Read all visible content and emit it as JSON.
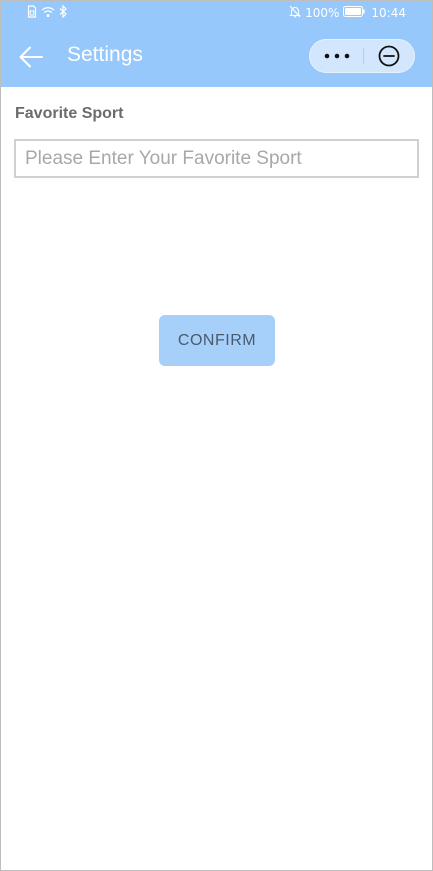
{
  "colors": {
    "header_bg": "#96c8fb",
    "capsule_bg": "#d2e7fd",
    "button_bg": "#a6d0fa",
    "label_text": "#6b6b6b",
    "placeholder_text": "#a8a8a8"
  },
  "status_bar": {
    "left_icons": [
      "sim-icon",
      "wifi-icon",
      "bluetooth-icon"
    ],
    "right_icons": [
      "mute-bell-icon",
      "battery-icon"
    ],
    "battery": "100%",
    "time": "10:44"
  },
  "app_bar": {
    "title": "Settings",
    "back_icon": "arrow-left-icon",
    "more_icon": "more-dots-icon",
    "close_icon": "minus-circle-icon"
  },
  "form": {
    "label": "Favorite Sport",
    "input": {
      "value": "",
      "placeholder": "Please Enter Your Favorite Sport"
    },
    "confirm_label": "CONFIRM"
  }
}
